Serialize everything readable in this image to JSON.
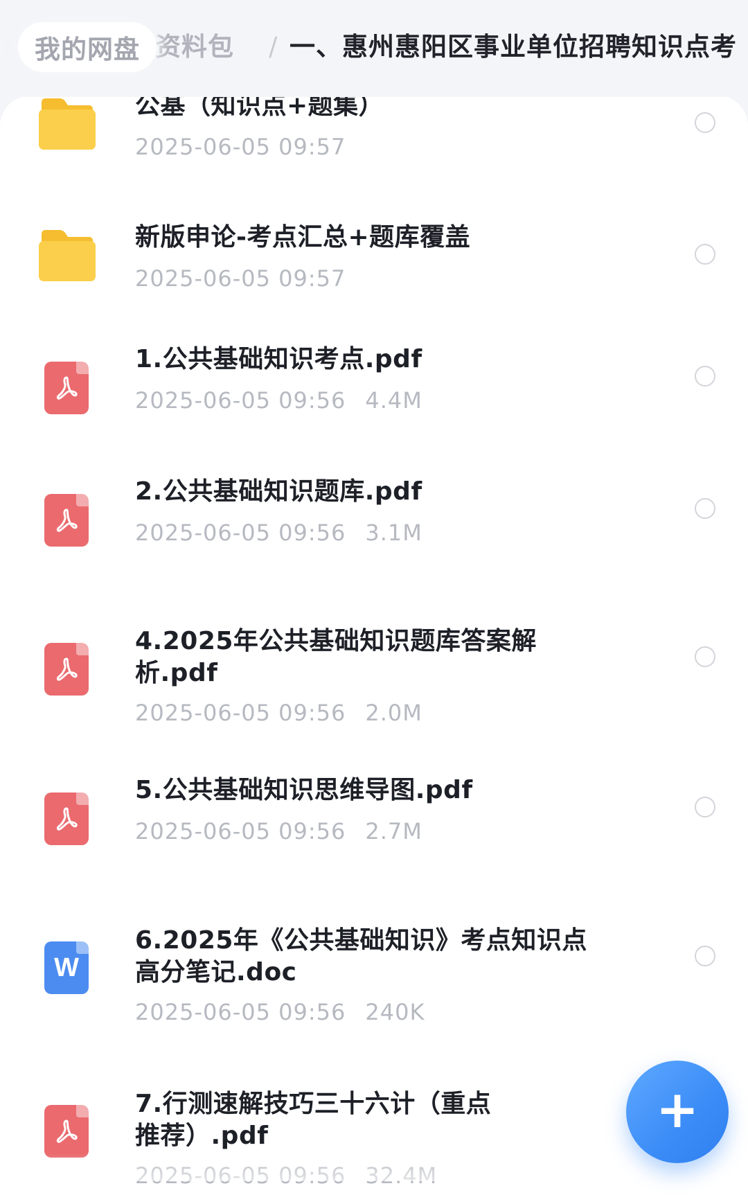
{
  "breadcrumb": {
    "home": "我的网盘",
    "middle": "考资料包",
    "separator": "/",
    "current": "一、惠州惠阳区事业单位招聘知识点考"
  },
  "files": [
    {
      "type": "folder",
      "icon": "folder-icon",
      "title": "公基（知识点+题集）",
      "date": "2025-06-05 09:57",
      "size": ""
    },
    {
      "type": "folder",
      "icon": "folder-icon",
      "title": "新版申论-考点汇总+题库覆盖",
      "date": "2025-06-05 09:57",
      "size": ""
    },
    {
      "type": "pdf",
      "icon": "pdf-icon",
      "title": "1.公共基础知识考点.pdf",
      "date": "2025-06-05 09:56",
      "size": "4.4M"
    },
    {
      "type": "pdf",
      "icon": "pdf-icon",
      "title": "2.公共基础知识题库.pdf",
      "date": "2025-06-05 09:56",
      "size": "3.1M"
    },
    {
      "type": "pdf",
      "icon": "pdf-icon",
      "title": "4.2025年公共基础知识题库答案解析.pdf",
      "date": "2025-06-05 09:56",
      "size": "2.0M"
    },
    {
      "type": "pdf",
      "icon": "pdf-icon",
      "title": "5.公共基础知识思维导图.pdf",
      "date": "2025-06-05 09:56",
      "size": "2.7M"
    },
    {
      "type": "doc",
      "icon": "word-icon",
      "title": "6.2025年《公共基础知识》考点知识点高分笔记.doc",
      "date": "2025-06-05 09:56",
      "size": "240K"
    },
    {
      "type": "pdf",
      "icon": "pdf-icon",
      "title": "7.行测速解技巧三十六计（重点推荐）.pdf",
      "date": "2025-06-05 09:56",
      "size": "32.4M"
    }
  ],
  "doc_icon_letter": "W",
  "fab_symbol": "+",
  "colors": {
    "folder": "#fbcf4b",
    "pdf": "#ea6a6e",
    "doc": "#4c8cf0",
    "accent": "#3b8cf7"
  }
}
